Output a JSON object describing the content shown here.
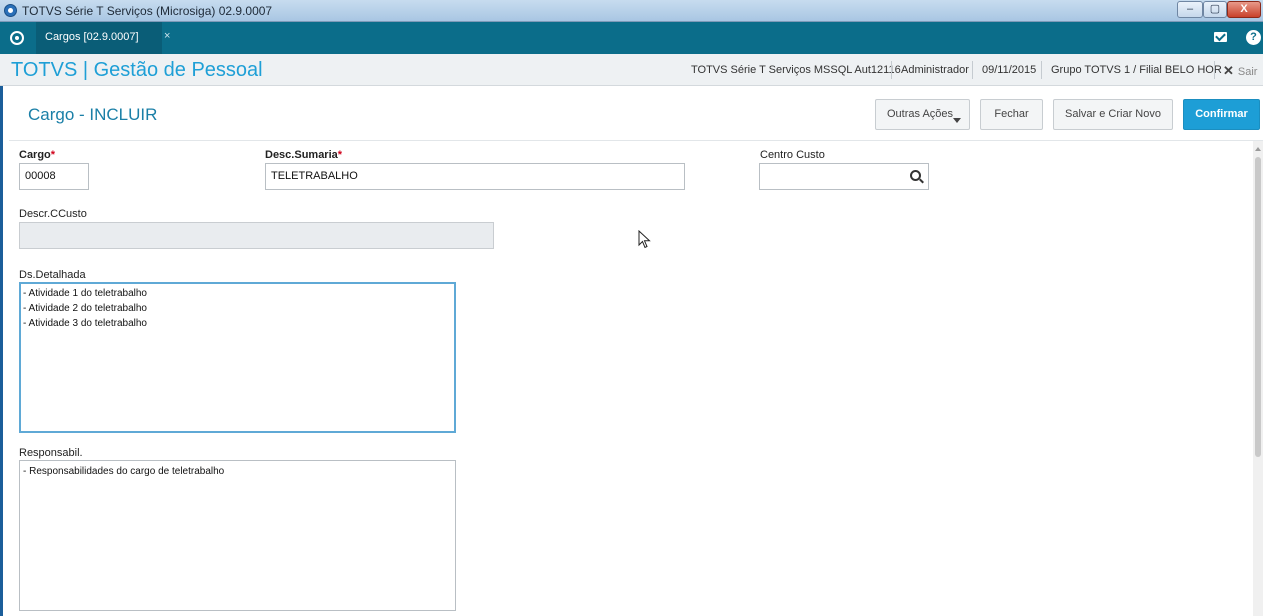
{
  "window": {
    "title": "TOTVS Série T Serviços (Microsiga) 02.9.0007",
    "minimize": "–",
    "maximize": "▢",
    "close": "X"
  },
  "tabs": [
    {
      "label": "Cargos [02.9.0007]",
      "close": "×"
    }
  ],
  "app_header": {
    "title": "TOTVS | Gestão de Pessoal",
    "environment": "TOTVS Série T Serviços MSSQL Aut12116",
    "user": "Administrador",
    "date": "09/11/2015",
    "branch": "Grupo TOTVS 1 / Filial BELO HOR",
    "exit_label": "Sair",
    "exit_icon": "✕"
  },
  "page": {
    "title": "Cargo - INCLUIR",
    "buttons": {
      "other_actions": "Outras Ações",
      "close": "Fechar",
      "save_new": "Salvar e Criar Novo",
      "confirm": "Confirmar"
    }
  },
  "form": {
    "cargo": {
      "label": "Cargo",
      "required_mark": "*",
      "value": "00008"
    },
    "desc_sumaria": {
      "label": "Desc.Sumaria",
      "required_mark": "*",
      "value": "TELETRABALHO"
    },
    "centro_custo": {
      "label": "Centro Custo",
      "value": ""
    },
    "descr_ccusto": {
      "label": "Descr.CCusto",
      "value": ""
    },
    "ds_detalhada": {
      "label": "Ds.Detalhada",
      "lines": [
        "- Atividade 1 do teletrabalho",
        "- Atividade 2 do teletrabalho",
        "- Atividade 3 do teletrabalho"
      ]
    },
    "responsabil": {
      "label": "Responsabil.",
      "lines": [
        "- Responsabilidades do cargo de teletrabalho"
      ]
    }
  },
  "colors": {
    "tabbar": "#0b6d8a",
    "accent": "#1d9ed6",
    "required": "#d0021b"
  }
}
